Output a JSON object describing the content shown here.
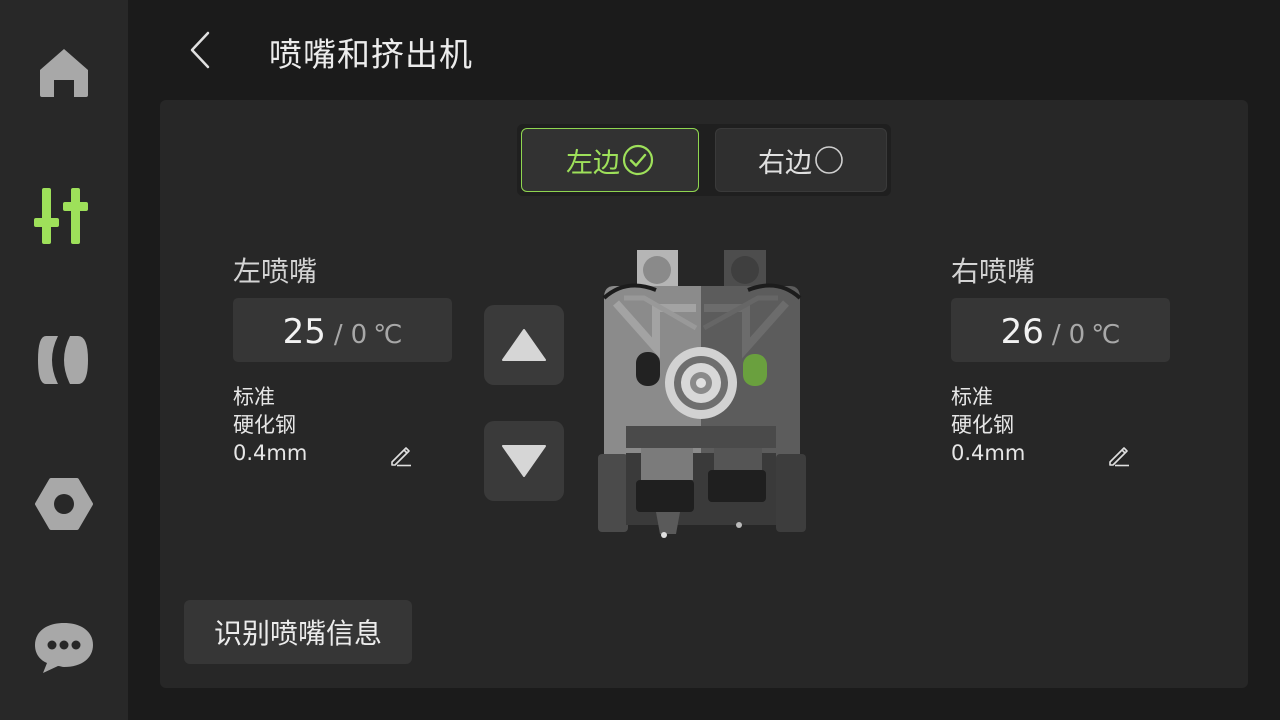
{
  "nav": {
    "items": [
      {
        "icon": "home-icon",
        "active": false
      },
      {
        "icon": "adjust-sliders-icon",
        "active": true
      },
      {
        "icon": "filament-spool-icon",
        "active": false
      },
      {
        "icon": "settings-nut-icon",
        "active": false
      },
      {
        "icon": "message-bubble-icon",
        "active": false
      }
    ],
    "active_color": "#9ee05a",
    "inactive_color": "#a8a8a8"
  },
  "header": {
    "title": "喷嘴和挤出机",
    "back_icon": "chevron-left-icon"
  },
  "selector": {
    "left_label": "左边",
    "right_label": "右边",
    "selected": "left",
    "selected_color": "#9ee05a"
  },
  "left_nozzle": {
    "label": "左喷嘴",
    "current_temp": "25",
    "separator": "/",
    "target_temp": "0",
    "unit": "℃",
    "type": "标准",
    "material": "硬化钢",
    "diameter": "0.4mm"
  },
  "right_nozzle": {
    "label": "右喷嘴",
    "current_temp": "26",
    "separator": "/",
    "target_temp": "0",
    "unit": "℃",
    "type": "标准",
    "material": "硬化钢",
    "diameter": "0.4mm"
  },
  "extruder_controls": {
    "up_icon": "triangle-up-icon",
    "down_icon": "triangle-down-icon"
  },
  "identify_button": {
    "label": "识别喷嘴信息"
  }
}
